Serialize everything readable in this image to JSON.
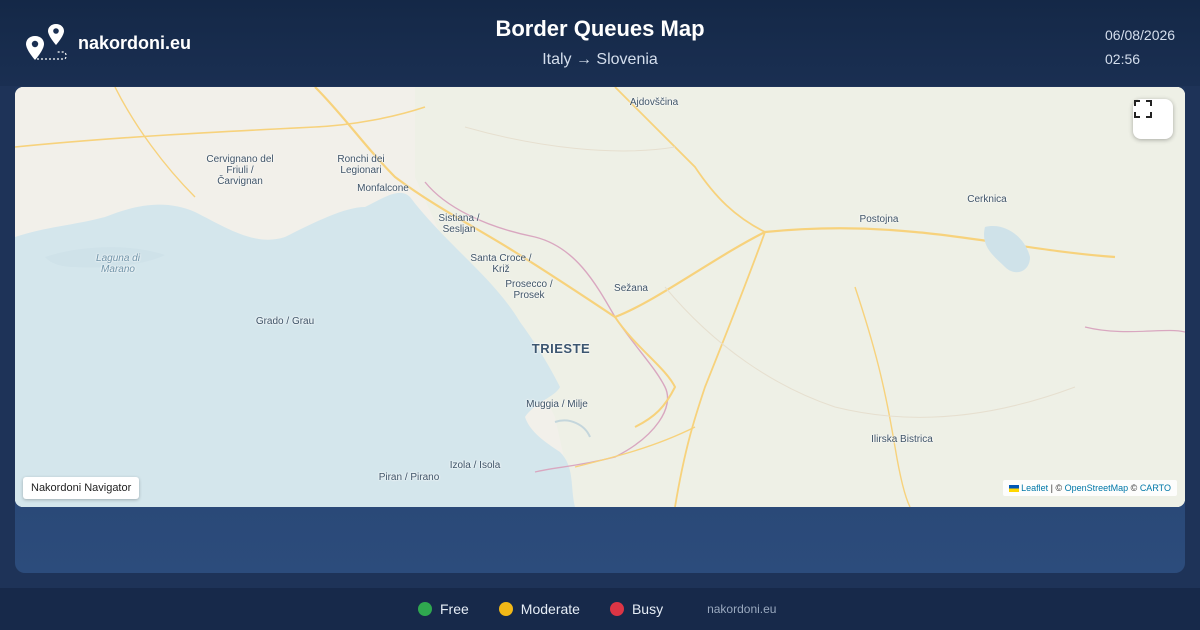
{
  "header": {
    "site_name": "nakordoni.eu",
    "title": "Border Queues Map",
    "subtitle": "Italy → Slovenia",
    "date": "06/08/2026",
    "time": "02:56"
  },
  "map": {
    "places": [
      {
        "label": "Ajdovščina",
        "type": "town"
      },
      {
        "label": "Cervignano del\nFriuli /\nČarvignan",
        "type": "town"
      },
      {
        "label": "Ronchi dei\nLegionari",
        "type": "town"
      },
      {
        "label": "Monfalcone",
        "type": "town"
      },
      {
        "label": "Sistiana /\nSesljan",
        "type": "town"
      },
      {
        "label": "Postojna",
        "type": "town"
      },
      {
        "label": "Cerknica",
        "type": "town"
      },
      {
        "label": "Laguna di\nMarano",
        "type": "water"
      },
      {
        "label": "Santa Croce /\nKriž",
        "type": "town"
      },
      {
        "label": "Prosecco /\nProsek",
        "type": "town"
      },
      {
        "label": "Sežana",
        "type": "town"
      },
      {
        "label": "Grado / Grau",
        "type": "town"
      },
      {
        "label": "TRIESTE",
        "type": "city"
      },
      {
        "label": "Muggia / Milje",
        "type": "town"
      },
      {
        "label": "Ilirska Bistrica",
        "type": "town"
      },
      {
        "label": "Izola / Isola",
        "type": "town"
      },
      {
        "label": "Piran / Pirano",
        "type": "town"
      }
    ],
    "navigator_label": "Nakordoni Navigator",
    "attribution": {
      "leaflet": "Leaflet",
      "sep1": " | © ",
      "osm": "OpenStreetMap",
      "sep2": " © ",
      "carto": "CARTO"
    },
    "fullscreen_icon": "fullscreen-icon",
    "colors": {
      "land": "#f2f0ea",
      "water": "#d4e6ec",
      "road": "#f7d27c",
      "border": "#d9a7c0"
    }
  },
  "legend": {
    "items": [
      {
        "label": "Free",
        "color": "#2fa84f"
      },
      {
        "label": "Moderate",
        "color": "#f2b817"
      },
      {
        "label": "Busy",
        "color": "#dc3545"
      }
    ],
    "site": "nakordoni.eu"
  }
}
